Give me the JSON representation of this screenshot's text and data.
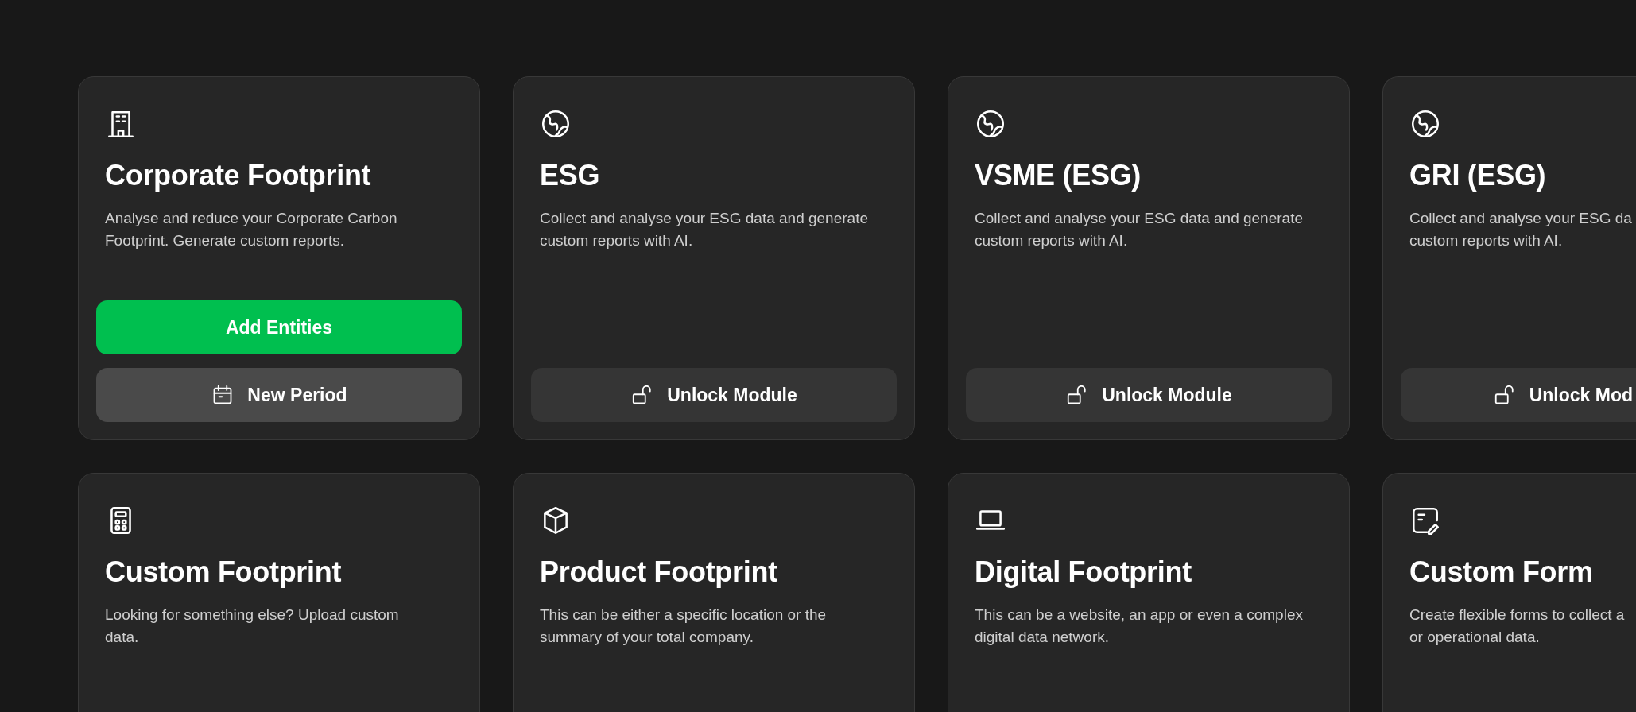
{
  "cards": [
    {
      "kind": "building",
      "title": "Corporate Footprint",
      "description_lines": [
        "Analyse and reduce your Corporate Carbon",
        "Footprint. Generate custom reports."
      ],
      "buttons": [
        {
          "kind": "primary",
          "label": "Add Entities"
        },
        {
          "kind": "period",
          "label": "New Period"
        }
      ]
    },
    {
      "kind": "globe",
      "title": "ESG",
      "description_lines": [
        "Collect and analyse your ESG data and generate",
        "custom reports with AI."
      ],
      "buttons": [
        {
          "kind": "unlock",
          "label": "Unlock Module"
        }
      ]
    },
    {
      "kind": "globe",
      "title": "VSME (ESG)",
      "description_lines": [
        "Collect and analyse your ESG data and generate",
        "custom reports with AI."
      ],
      "buttons": [
        {
          "kind": "unlock",
          "label": "Unlock Module"
        }
      ]
    },
    {
      "kind": "globe",
      "title": "GRI (ESG)",
      "description_lines": [
        "Collect and analyse your ESG da",
        "custom reports with AI."
      ],
      "buttons": [
        {
          "kind": "unlock",
          "label": "Unlock Mod"
        }
      ]
    },
    {
      "kind": "calculator",
      "title": "Custom Footprint",
      "description_lines": [
        "Looking for something else? Upload custom",
        "data."
      ]
    },
    {
      "kind": "cube",
      "title": "Product Footprint",
      "description_lines": [
        "This can be either a specific location or the",
        "summary of your total company."
      ]
    },
    {
      "kind": "laptop",
      "title": "Digital Footprint",
      "description_lines": [
        "This can be a website, an app or even a complex",
        "digital data network."
      ]
    },
    {
      "kind": "form",
      "title": "Custom Form",
      "description_lines": [
        "Create flexible forms to collect a",
        "or operational data."
      ]
    }
  ]
}
